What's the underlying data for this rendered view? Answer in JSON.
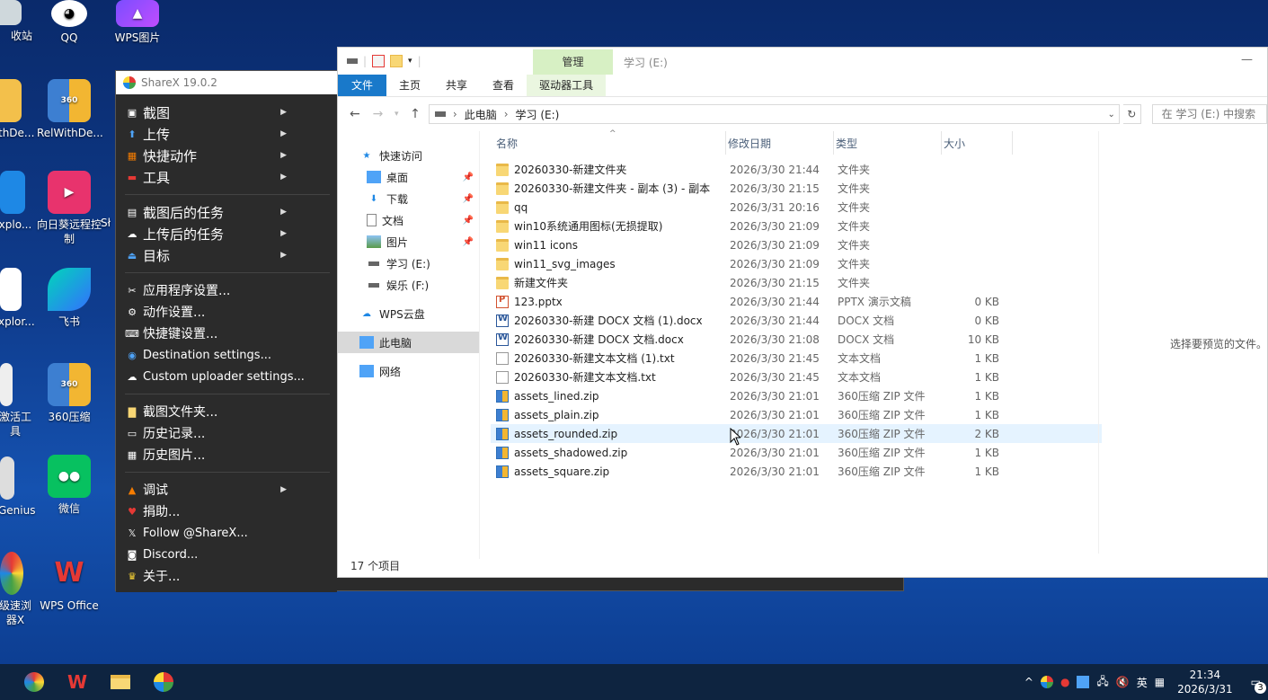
{
  "desktop": {
    "icons": [
      {
        "label": "收站",
        "x_hint": "recycle"
      },
      {
        "label": "QQ"
      },
      {
        "label": "WPS图片"
      },
      {
        "label": "thDe..."
      },
      {
        "label": "RelWithDe..."
      },
      {
        "label": "xplo..."
      },
      {
        "label": "向日葵远程控制"
      },
      {
        "label": "Sł"
      },
      {
        "label": "xplor..."
      },
      {
        "label": "飞书"
      },
      {
        "label": "激活工具"
      },
      {
        "label": "360压缩"
      },
      {
        "label": "Genius"
      },
      {
        "label": "微信"
      },
      {
        "label": "级速浏器X"
      },
      {
        "label": "WPS Office"
      }
    ]
  },
  "sharex": {
    "title": "ShareX 19.0.2",
    "menu": {
      "capture": "截图",
      "upload": "上传",
      "workflows": "快捷动作",
      "tools": "工具",
      "after_capture": "截图后的任务",
      "after_upload": "上传后的任务",
      "destinations": "目标",
      "app_settings": "应用程序设置...",
      "task_settings": "动作设置...",
      "hotkey_settings": "快捷键设置...",
      "destination_settings": "Destination settings...",
      "custom_uploader": "Custom uploader settings...",
      "screenshots_folder": "截图文件夹...",
      "history": "历史记录...",
      "image_history": "历史图片...",
      "debug": "调试",
      "donate": "捐助...",
      "follow": "Follow @ShareX...",
      "discord": "Discord...",
      "about": "关于..."
    }
  },
  "explorer": {
    "manage_tab": "管理",
    "window_title": "学习 (E:)",
    "ribbon": {
      "file": "文件",
      "home": "主页",
      "share": "共享",
      "view": "查看",
      "drive_tools": "驱动器工具"
    },
    "address": {
      "crumb1": "此电脑",
      "crumb2": "学习 (E:)",
      "search_placeholder": "在 学习 (E:) 中搜索"
    },
    "nav": {
      "quick_access": "快速访问",
      "desktop": "桌面",
      "downloads": "下载",
      "documents": "文档",
      "pictures": "图片",
      "drive_e": "学习 (E:)",
      "drive_f": "娱乐 (F:)",
      "wps_cloud": "WPS云盘",
      "this_pc": "此电脑",
      "network": "网络"
    },
    "columns": {
      "name": "名称",
      "date": "修改日期",
      "type": "类型",
      "size": "大小"
    },
    "files": [
      {
        "name": "20260330-新建文件夹",
        "date": "2026/3/30 21:44",
        "type": "文件夹",
        "size": "",
        "icon": "folder"
      },
      {
        "name": "20260330-新建文件夹 - 副本 (3) - 副本",
        "date": "2026/3/30 21:15",
        "type": "文件夹",
        "size": "",
        "icon": "folder"
      },
      {
        "name": "qq",
        "date": "2026/3/31 20:16",
        "type": "文件夹",
        "size": "",
        "icon": "folder"
      },
      {
        "name": "win10系统通用图标(无损提取)",
        "date": "2026/3/30 21:09",
        "type": "文件夹",
        "size": "",
        "icon": "folder"
      },
      {
        "name": "win11 icons",
        "date": "2026/3/30 21:09",
        "type": "文件夹",
        "size": "",
        "icon": "folder"
      },
      {
        "name": "win11_svg_images",
        "date": "2026/3/30 21:09",
        "type": "文件夹",
        "size": "",
        "icon": "folder"
      },
      {
        "name": "新建文件夹",
        "date": "2026/3/30 21:15",
        "type": "文件夹",
        "size": "",
        "icon": "folder"
      },
      {
        "name": "123.pptx",
        "date": "2026/3/30 21:44",
        "type": "PPTX 演示文稿",
        "size": "0 KB",
        "icon": "pptx"
      },
      {
        "name": "20260330-新建 DOCX 文档 (1).docx",
        "date": "2026/3/30 21:44",
        "type": "DOCX 文档",
        "size": "0 KB",
        "icon": "docx"
      },
      {
        "name": "20260330-新建 DOCX 文档.docx",
        "date": "2026/3/30 21:08",
        "type": "DOCX 文档",
        "size": "10 KB",
        "icon": "docx"
      },
      {
        "name": "20260330-新建文本文档 (1).txt",
        "date": "2026/3/30 21:45",
        "type": "文本文档",
        "size": "1 KB",
        "icon": "txt"
      },
      {
        "name": "20260330-新建文本文档.txt",
        "date": "2026/3/30 21:45",
        "type": "文本文档",
        "size": "1 KB",
        "icon": "txt"
      },
      {
        "name": "assets_lined.zip",
        "date": "2026/3/30 21:01",
        "type": "360压缩 ZIP 文件",
        "size": "1 KB",
        "icon": "zip"
      },
      {
        "name": "assets_plain.zip",
        "date": "2026/3/30 21:01",
        "type": "360压缩 ZIP 文件",
        "size": "1 KB",
        "icon": "zip"
      },
      {
        "name": "assets_rounded.zip",
        "date": "2026/3/30 21:01",
        "type": "360压缩 ZIP 文件",
        "size": "2 KB",
        "icon": "zip"
      },
      {
        "name": "assets_shadowed.zip",
        "date": "2026/3/30 21:01",
        "type": "360压缩 ZIP 文件",
        "size": "1 KB",
        "icon": "zip"
      },
      {
        "name": "assets_square.zip",
        "date": "2026/3/30 21:01",
        "type": "360压缩 ZIP 文件",
        "size": "1 KB",
        "icon": "zip"
      }
    ],
    "preview_text": "选择要预览的文件。",
    "status": "17 个项目"
  },
  "taskbar": {
    "ime": "英",
    "time": "21:34",
    "date": "2026/3/31",
    "notification_count": "3"
  }
}
